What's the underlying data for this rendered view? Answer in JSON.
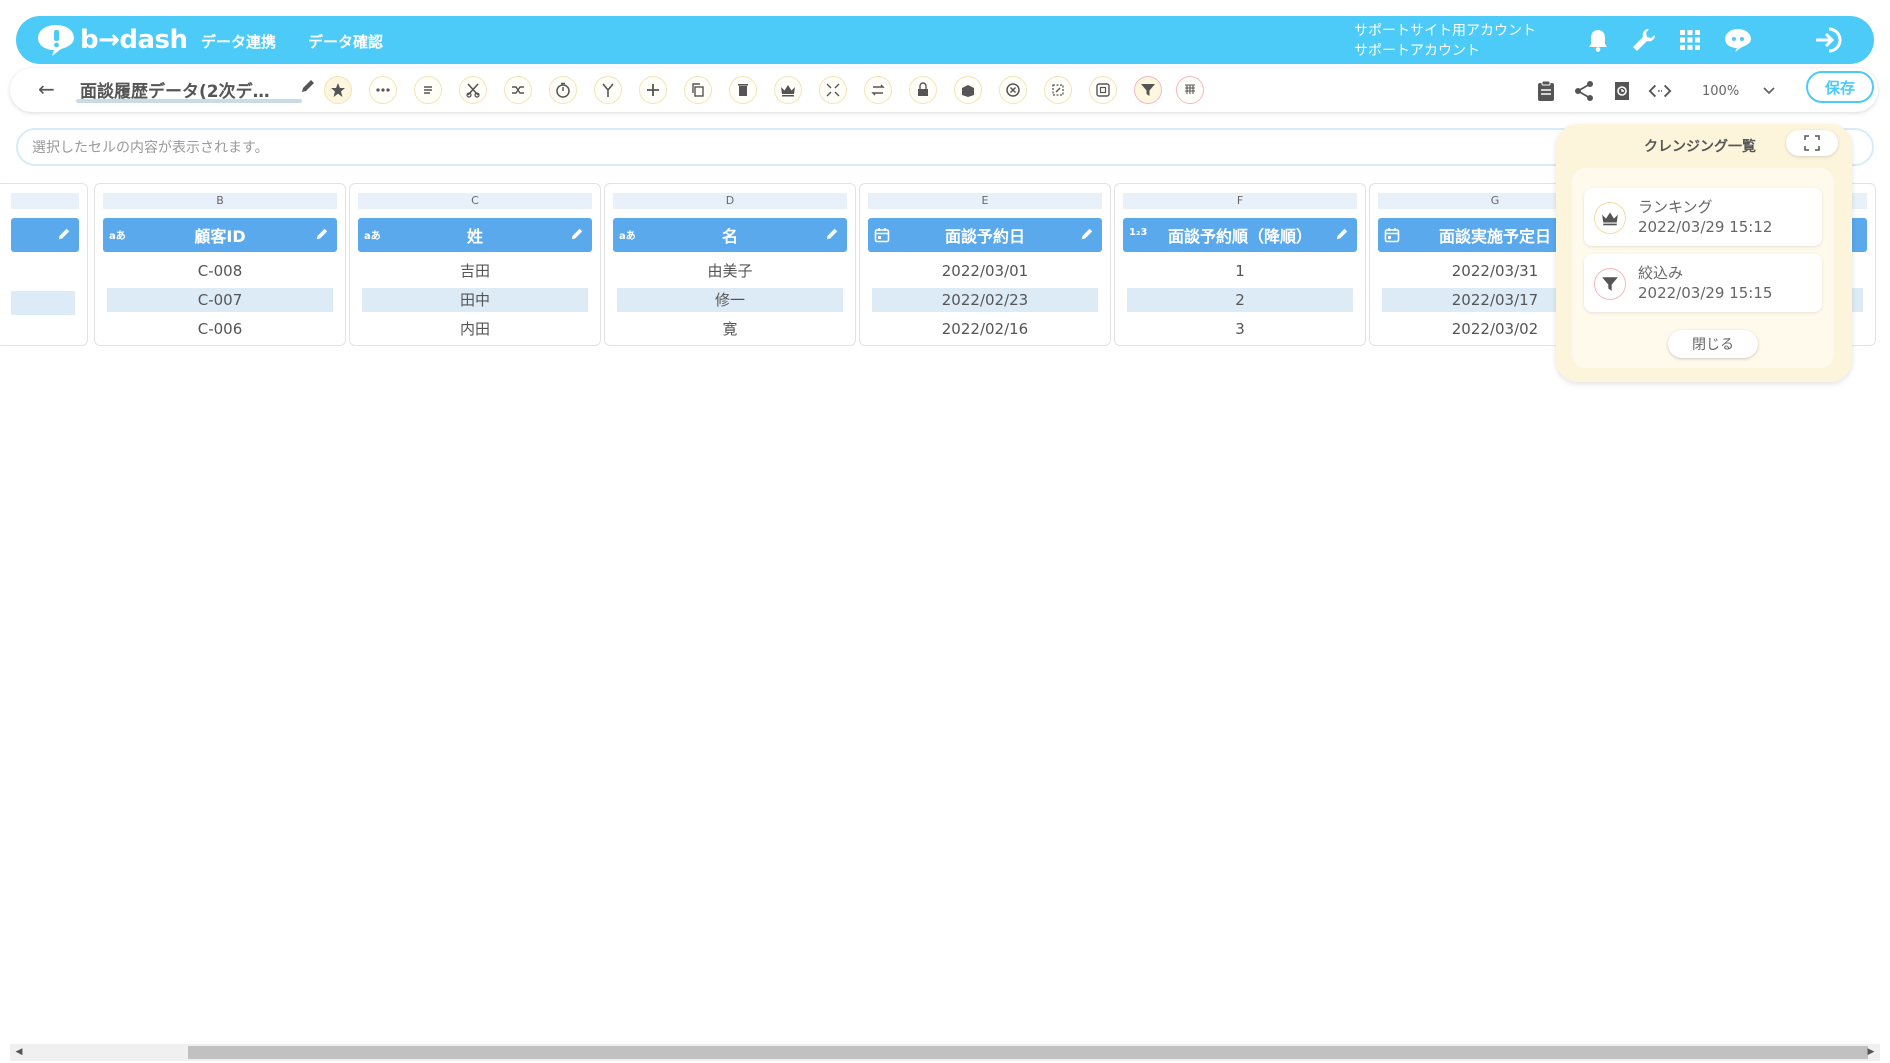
{
  "header": {
    "logo_text": "b→dash",
    "nav": [
      "データ連携",
      "データ確認"
    ],
    "account_line1": "サポートサイト用アカウント",
    "account_line2": "サポートアカウント",
    "icons": [
      "bell-icon",
      "wrench-icon",
      "apps-grid-icon",
      "chat-bot-icon",
      "logout-icon"
    ]
  },
  "toolbar": {
    "back_icon": "←",
    "sheet_title": "面談履歴データ(2次デ…",
    "tools": [
      "star",
      "more-horizontal",
      "text-lines",
      "scissors",
      "merge",
      "timer",
      "branch",
      "plus",
      "copy",
      "trash",
      "crown",
      "compress",
      "swap",
      "lock-box",
      "box-arrow",
      "x-circle",
      "refresh-shape",
      "frame",
      "filter",
      "dedupe-grid"
    ],
    "right_icons": [
      "clipboard-icon",
      "share-icon",
      "history-icon",
      "code-icon"
    ],
    "zoom": "100%",
    "save_label": "保存"
  },
  "cell_bar": {
    "placeholder": "選択したセルの内容が表示されます。"
  },
  "columns": [
    {
      "letter": "",
      "header": "",
      "type": "",
      "cells": [
        "",
        "",
        ""
      ]
    },
    {
      "letter": "B",
      "header": "顧客ID",
      "type": "aあ",
      "cells": [
        "C-008",
        "C-007",
        "C-006"
      ]
    },
    {
      "letter": "C",
      "header": "姓",
      "type": "aあ",
      "cells": [
        "吉田",
        "田中",
        "内田"
      ]
    },
    {
      "letter": "D",
      "header": "名",
      "type": "aあ",
      "cells": [
        "由美子",
        "修一",
        "寛"
      ]
    },
    {
      "letter": "E",
      "header": "面談予約日",
      "type": "calendar",
      "cells": [
        "2022/03/01",
        "2022/02/23",
        "2022/02/16"
      ]
    },
    {
      "letter": "F",
      "header": "面談予約順（降順）",
      "type": "1₂3",
      "cells": [
        "1",
        "2",
        "3"
      ]
    },
    {
      "letter": "G",
      "header": "面談実施予定日",
      "type": "calendar",
      "cells": [
        "2022/03/31",
        "2022/03/17",
        "2022/03/02"
      ]
    }
  ],
  "cleansing_panel": {
    "title": "クレンジング一覧",
    "items": [
      {
        "name": "ランキング",
        "time": "2022/03/29 15:12",
        "icon": "crown-icon"
      },
      {
        "name": "絞込み",
        "time": "2022/03/29 15:15",
        "icon": "filter-icon"
      }
    ],
    "close_label": "閉じる"
  },
  "colors": {
    "brand": "#4ccbf9",
    "column_header": "#5aa9ed",
    "row_alt": "#ddebf7",
    "panel_bg": "#fdf4dc"
  }
}
